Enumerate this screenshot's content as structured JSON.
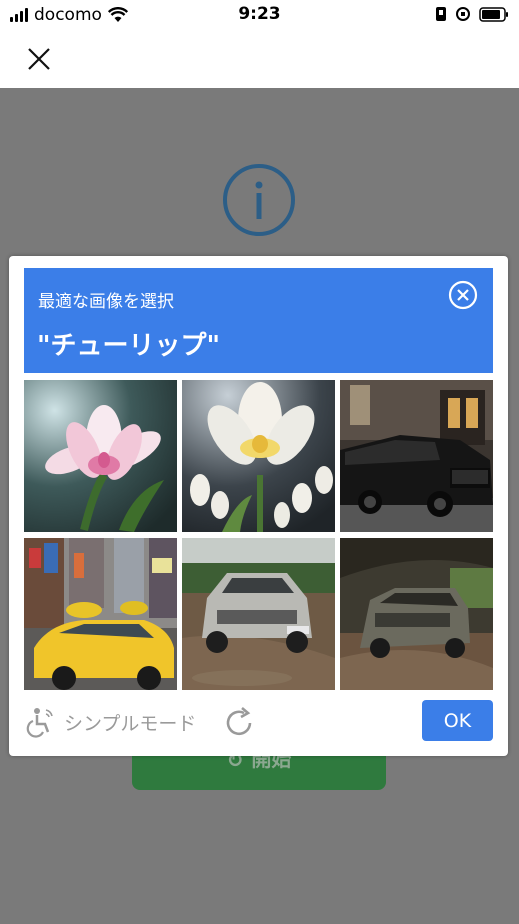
{
  "status_bar": {
    "carrier": "docomo",
    "time": "9:23",
    "icons": [
      "signal-bars-icon",
      "wifi-icon",
      "portrait-lock-icon",
      "rotation-lock-icon",
      "battery-icon"
    ]
  },
  "nav": {
    "close_icon": "close-icon"
  },
  "background": {
    "info_icon": "info-icon",
    "start_button_label": "開始"
  },
  "captcha": {
    "prompt": "最適な画像を選択",
    "target": "\"チューリップ\"",
    "tiles": [
      {
        "subject": "pink-white tulip flower",
        "accent": "#e88bb0"
      },
      {
        "subject": "white tulips",
        "accent": "#f2d86a"
      },
      {
        "subject": "black limousine",
        "accent": "#1a1a1a"
      },
      {
        "subject": "yellow taxi city street",
        "accent": "#f0c52a"
      },
      {
        "subject": "silver SUV on muddy road",
        "accent": "#b9b9b4"
      },
      {
        "subject": "dark SUV muddy path",
        "accent": "#6b6a5e"
      }
    ],
    "simple_mode_label": "シンプルモード",
    "ok_label": "OK",
    "accent_color": "#3b7ee8"
  }
}
